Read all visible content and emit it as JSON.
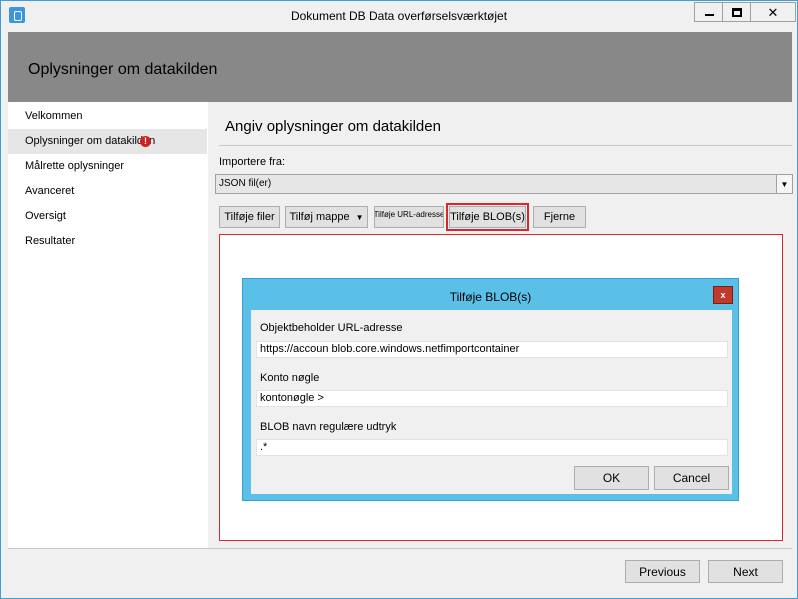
{
  "window": {
    "title": "Dokument DB Data overførselsværktøjet",
    "minimize_glyph": "",
    "close_glyph": "✕"
  },
  "header": {
    "title": "Oplysninger om datakilden"
  },
  "nav": {
    "items": [
      {
        "label": "Velkommen"
      },
      {
        "label": "Oplysninger om datakilden",
        "selected": true,
        "has_warning": true
      },
      {
        "label": "Målrette oplysninger"
      },
      {
        "label": "Avanceret"
      },
      {
        "label": "Oversigt"
      },
      {
        "label": "Resultater"
      }
    ],
    "warning_glyph": "!"
  },
  "main": {
    "section_title": "Angiv oplysninger om datakilden",
    "import_label": "Importere fra:",
    "import_value": "JSON fil(er)",
    "dropdown_arrow": "▼",
    "buttons": {
      "add_files": "Tilføje filer",
      "add_folder": "Tilføj mappe",
      "add_folder_caret": "▼",
      "add_url": "Tilføje URL-adresse",
      "add_blob": "Tilføje BLOB(s)",
      "remove": "Fjerne"
    }
  },
  "dialog": {
    "title": "Tilføje BLOB(s)",
    "close": "x",
    "container_url_label": "Objektbeholder URL-adresse",
    "container_url_value": "https://accoun blob.core.windows.netfimportcontainer",
    "account_key_label": "Konto nøgle",
    "account_key_value": "kontonøgle >",
    "blob_regex_label": "BLOB navn regulære udtryk",
    "blob_regex_value": ".*",
    "ok": "OK",
    "cancel": "Cancel"
  },
  "footer": {
    "previous": "Previous",
    "next": "Next"
  },
  "colors": {
    "accent": "#5bc0e8",
    "highlight": "#d9272e",
    "header_band": "#888888"
  }
}
